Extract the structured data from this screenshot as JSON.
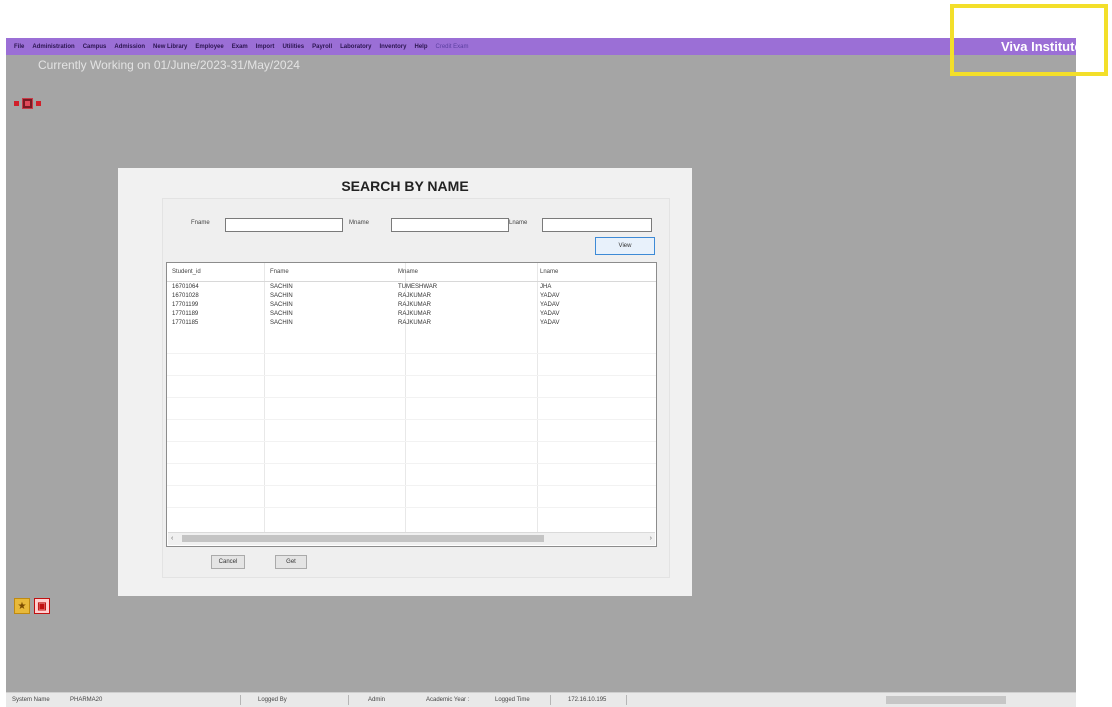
{
  "menubar": {
    "items": [
      "File",
      "Administration",
      "Campus",
      "Admission",
      "New Library",
      "Employee",
      "Exam",
      "Import",
      "Utilities",
      "Payroll",
      "Laboratory",
      "Inventory",
      "Help",
      "Credit Exam"
    ],
    "brand": "Viva Institute"
  },
  "working_text": "Currently Working on 01/June/2023-31/May/2024",
  "dialog": {
    "title": "SEARCH BY NAME",
    "fname_label": "Fname",
    "mname_label": "Mname",
    "lname_label": "Lname",
    "fname_value": "",
    "mname_value": "",
    "lname_value": "",
    "view_button": "View",
    "cancel_button": "Cancel",
    "get_button": "Get",
    "grid": {
      "columns": [
        "Student_id",
        "Fname",
        "Mname",
        "Lname"
      ],
      "rows": [
        [
          "16701064",
          "SACHIN",
          "TUMESHWAR",
          "JHA"
        ],
        [
          "16701028",
          "SACHIN",
          "RAJKUMAR",
          "YADAV"
        ],
        [
          "17701199",
          "SACHIN",
          "RAJKUMAR",
          "YADAV"
        ],
        [
          "17701189",
          "SACHIN",
          "RAJKUMAR",
          "YADAV"
        ],
        [
          "17701185",
          "SACHIN",
          "RAJKUMAR",
          "YADAV"
        ]
      ]
    }
  },
  "status": {
    "system_name_label": "System Name",
    "system_name_value": "PHARMA20",
    "logged_by_label": "Logged By",
    "logged_by_value": "Admin",
    "academic_year_label": "Academic Year :",
    "logged_time_label": "Logged Time",
    "logged_time_value": "172.16.10.195"
  },
  "colors": {
    "menubar": "#9b6fd6",
    "workspace": "#a5a5a5",
    "highlight": "#f3df2a"
  }
}
